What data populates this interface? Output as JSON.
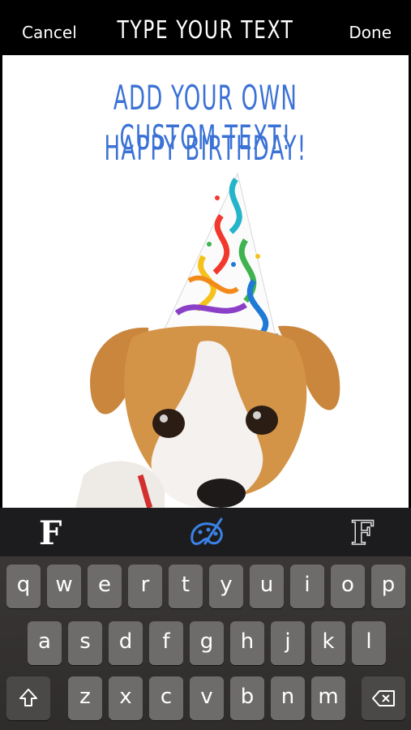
{
  "header": {
    "cancel_label": "Cancel",
    "title": "TYPE YOUR TEXT",
    "done_label": "Done"
  },
  "card": {
    "line1": "ADD YOUR OWN CUSTOM TEXT!",
    "line2": "HAPPY BIRTHDAY!",
    "text_color": "#3b72d6"
  },
  "toolbar": {
    "font_label": "F",
    "outline_label": "F",
    "color_icon": "paint-palette-icon"
  },
  "keyboard": {
    "row1": [
      "q",
      "w",
      "e",
      "r",
      "t",
      "y",
      "u",
      "i",
      "o",
      "p"
    ],
    "row2": [
      "a",
      "s",
      "d",
      "f",
      "g",
      "h",
      "j",
      "k",
      "l"
    ],
    "row3": [
      "z",
      "x",
      "c",
      "v",
      "b",
      "n",
      "m"
    ],
    "shift_icon": "shift-arrow-icon",
    "delete_icon": "backspace-icon"
  }
}
